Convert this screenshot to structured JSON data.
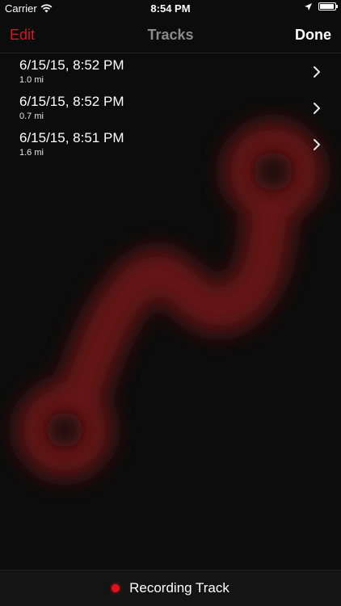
{
  "status_bar": {
    "carrier": "Carrier",
    "time": "8:54 PM",
    "battery_level": 0.95
  },
  "nav": {
    "left_label": "Edit",
    "title": "Tracks",
    "right_label": "Done"
  },
  "tracks": [
    {
      "title": "6/15/15, 8:52 PM",
      "distance": "1.0 mi"
    },
    {
      "title": "6/15/15, 8:52 PM",
      "distance": "0.7 mi"
    },
    {
      "title": "6/15/15, 8:51 PM",
      "distance": "1.6 mi"
    }
  ],
  "toolbar": {
    "label": "Recording Track"
  },
  "colors": {
    "accent": "#d3182b",
    "background": "#0c0c0c",
    "route_glow": "#7a1419"
  }
}
